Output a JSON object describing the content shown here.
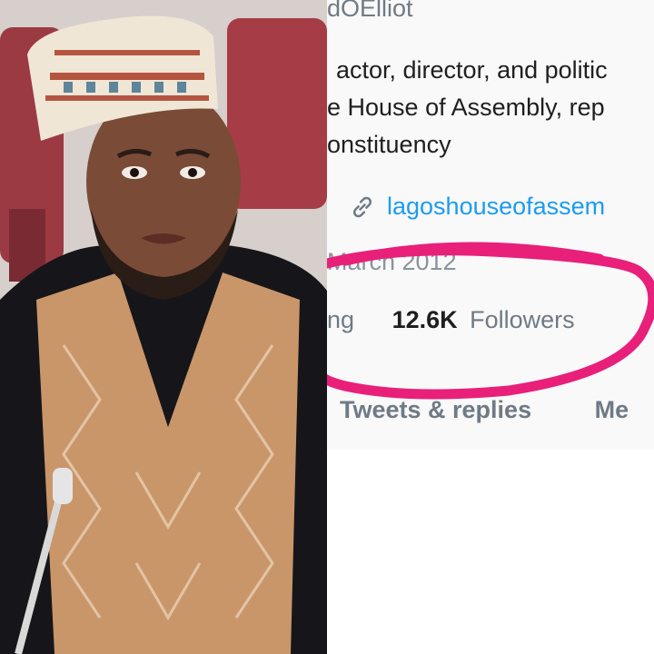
{
  "profile": {
    "handle_fragment": "dOElliot",
    "bio_lines": [
      "actor, director, and politic",
      "e House of Assembly, rep",
      "onstituency"
    ],
    "link": {
      "icon": "link-icon",
      "text": "lagoshouseofassem"
    },
    "joined_fragment": "March 2012",
    "stats": {
      "following_fragment": "ng",
      "followers_count": "12.6K",
      "followers_label": "Followers"
    },
    "tabs": [
      {
        "label": "Tweets & replies"
      },
      {
        "label": "Me"
      }
    ]
  },
  "annotation": {
    "color": "#e8207a"
  },
  "photo": {
    "subject": "person-portrait"
  }
}
